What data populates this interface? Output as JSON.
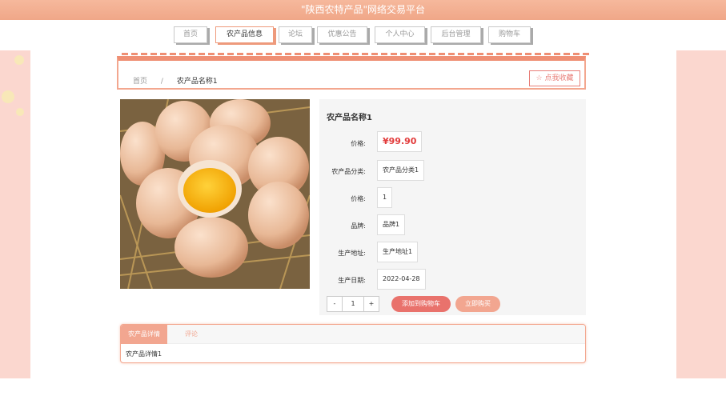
{
  "site": {
    "title": "\"陕西农特产品\"网络交易平台"
  },
  "nav": {
    "items": [
      {
        "label": "首页",
        "active": false
      },
      {
        "label": "农产品信息",
        "active": true
      },
      {
        "label": "论坛",
        "active": false
      },
      {
        "label": "优惠公告",
        "active": false
      },
      {
        "label": "个人中心",
        "active": false
      },
      {
        "label": "后台管理",
        "active": false
      },
      {
        "label": "购物车",
        "active": false
      }
    ]
  },
  "breadcrumb": {
    "home": "首页",
    "separator": "/",
    "current": "农产品名称1"
  },
  "favorite": {
    "icon": "star-outline-icon",
    "label": "点我收藏"
  },
  "product": {
    "name": "农产品名称1",
    "price_label": "价格:",
    "price_value": "¥99.90",
    "category_label": "农产品分类:",
    "category_value": "农产品分类1",
    "price2_label": "价格:",
    "price2_value": "1",
    "brand_label": "品牌:",
    "brand_value": "品牌1",
    "origin_label": "生产地址:",
    "origin_value": "生产地址1",
    "date_label": "生产日期:",
    "date_value": "2022-04-28"
  },
  "quantity": {
    "minus": "-",
    "value": "1",
    "plus": "+"
  },
  "actions": {
    "add_to_cart": "添加到购物车",
    "buy_now": "立即购买"
  },
  "details": {
    "tabs": [
      {
        "label": "农产品详情",
        "active": true
      },
      {
        "label": "评论",
        "active": false
      }
    ],
    "content": "农产品详情1"
  },
  "colors": {
    "accent": "#f0a788",
    "price": "#e23b3b",
    "cart": "#e9726c",
    "buy": "#f2a690",
    "side": "#fbd7cf"
  }
}
